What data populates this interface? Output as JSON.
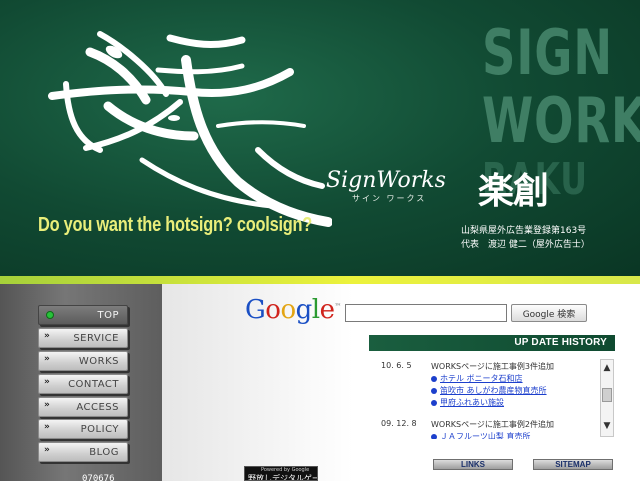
{
  "header": {
    "watermark_lines": [
      "SIGN",
      "WORKS",
      "RAKU"
    ],
    "brand_script": "SignWorks",
    "brand_kana": "サイン ワークス",
    "brand_kanji": "楽創",
    "tagline": "Do you want the hotsign? coolsign?",
    "registration": "山梨県屋外広告業登録第163号",
    "representative": "代表　渡辺 健二（屋外広告士）"
  },
  "nav": {
    "items": [
      {
        "label": "TOP",
        "active": true
      },
      {
        "label": "SERVICE",
        "active": false
      },
      {
        "label": "WORKS",
        "active": false
      },
      {
        "label": "CONTACT",
        "active": false
      },
      {
        "label": "ACCESS",
        "active": false
      },
      {
        "label": "POLICY",
        "active": false
      },
      {
        "label": "BLOG",
        "active": false
      }
    ],
    "arrow_icon": "»",
    "counter": "070676"
  },
  "search": {
    "logo": [
      "G",
      "o",
      "o",
      "g",
      "l",
      "e"
    ],
    "logo_tm": "™",
    "input_value": "",
    "button_label": "Google 検索"
  },
  "history": {
    "title": "UP DATE HISTORY",
    "entries": [
      {
        "date": "10. 6. 5",
        "title": "WORKSページに施工事例3件追加",
        "links": [
          "ホテル ボニータ石和店",
          "笛吹市 あしがわ農産物直売所",
          "甲府ふれあい施設"
        ]
      },
      {
        "date": "09. 12. 8",
        "title": "WORKSページに施工事例2件追加",
        "links": [
          "ＪＡフルーツ山梨 直売所"
        ]
      }
    ]
  },
  "footer_buttons": {
    "links": "LINKS",
    "sitemap": "SITEMAP"
  },
  "banner": {
    "small": "Powered by Google",
    "main": "野放しデジタルゲーム"
  },
  "colors": {
    "header_green": "#114a33",
    "accent_yellow": "#ecf23c",
    "tagline_yellow": "#e9ee7a",
    "link_blue": "#1c3fcc"
  }
}
